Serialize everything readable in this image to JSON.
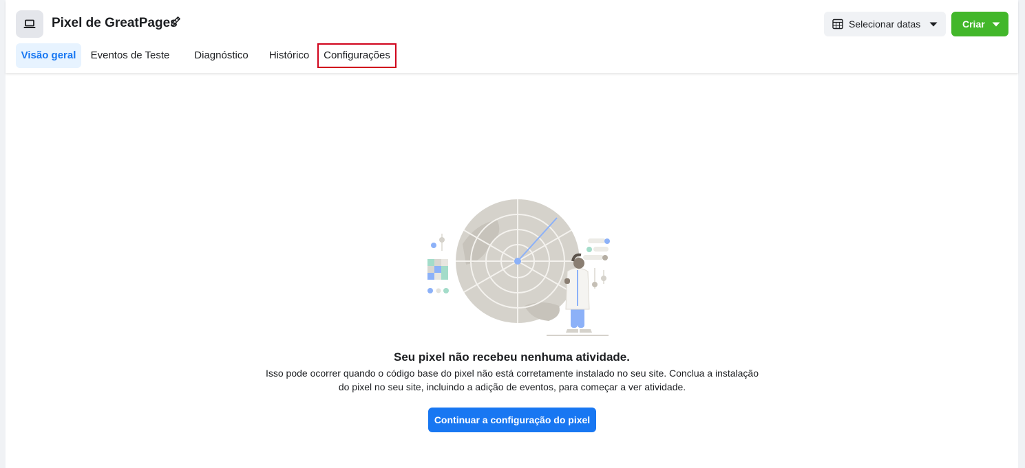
{
  "header": {
    "title": "Pixel de GreatPages",
    "icons": {
      "pixel": "laptop-icon",
      "edit": "pencil-icon"
    }
  },
  "tabs": [
    {
      "label": "Visão geral",
      "active": true
    },
    {
      "label": "Eventos de Teste",
      "active": false
    },
    {
      "label": "Diagnóstico",
      "active": false
    },
    {
      "label": "Histórico",
      "active": false
    },
    {
      "label": "Configurações",
      "active": false,
      "highlighted": true
    }
  ],
  "toolbar": {
    "date_label": "Selecionar datas",
    "date_icon": "calendar-icon",
    "create_label": "Criar",
    "create_color": "#42b72a"
  },
  "empty_state": {
    "title": "Seu pixel não recebeu nenhuma atividade.",
    "description": "Isso pode ocorrer quando o código base do pixel não está corretamente instalado no seu site. Conclua a instalação do pixel no seu site, incluindo a adição de eventos, para começar a ver atividade.",
    "cta_label": "Continuar a configuração do pixel",
    "cta_color": "#1877f2"
  },
  "colors": {
    "accent": "#1877f2",
    "active_tab_bg": "#e7f3ff",
    "highlight_box": "#d0021b"
  }
}
